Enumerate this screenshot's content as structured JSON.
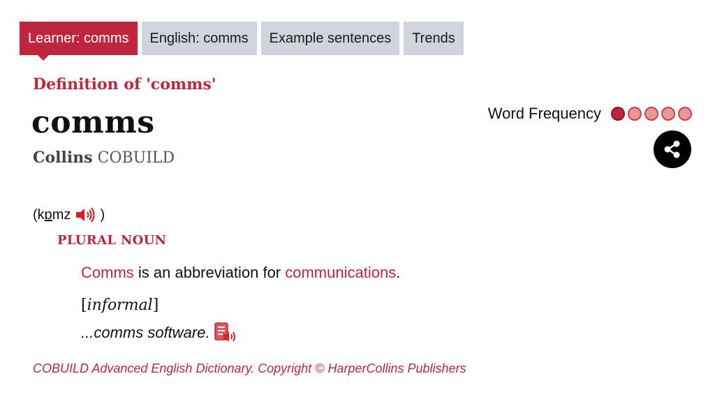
{
  "tabs": [
    {
      "label": "Learner: comms",
      "active": true
    },
    {
      "label": "English: comms",
      "active": false
    },
    {
      "label": "Example sentences",
      "active": false
    },
    {
      "label": "Trends",
      "active": false
    }
  ],
  "entry": {
    "definition_heading": "Definition of 'comms'",
    "headword": "comms",
    "source_brand": "Collins",
    "source_name": "COBUILD",
    "word_frequency_label": "Word Frequency",
    "word_frequency_level": 1,
    "word_frequency_max": 5,
    "pron_open": "(",
    "pron_pre": "k",
    "pron_underlined": "ɒ",
    "pron_post": "mz",
    "pron_close": ")",
    "part_of_speech": "PLURAL NOUN",
    "sense": {
      "term": "Comms",
      "text_mid": " is an abbreviation for ",
      "link": "communications",
      "text_end": "."
    },
    "register_open": "[",
    "register": "informal",
    "register_close": "]",
    "example": "...comms software."
  },
  "footer": {
    "copyright": "COBUILD Advanced English Dictionary. Copyright © HarperCollins Publishers"
  },
  "icons": {
    "speaker": "speaker-icon",
    "example_audio": "example-audio-icon",
    "share": "share-icon"
  },
  "colors": {
    "accent": "#c0253e",
    "tab_inactive": "#cfd4dd",
    "freq_dot_on": "#c0253e",
    "freq_dot_off": "#ea9797"
  }
}
